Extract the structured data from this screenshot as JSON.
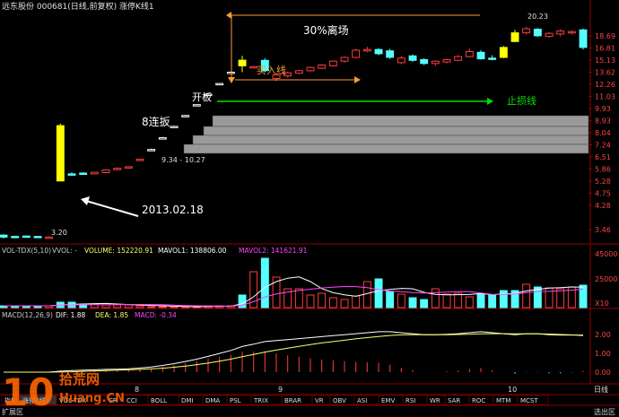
{
  "header": {
    "title": "远东股份 000681(日线,前复权) 涨停K线1"
  },
  "colors": {
    "up": "#ff3c3c",
    "down": "#54ffff",
    "limit_up": "#ffff00",
    "white": "#ffffff",
    "grid": "#8b0000",
    "orange": "#ff9a2e",
    "green": "#00e000",
    "magenta": "#ff44ff",
    "yellow_line": "#ffff66"
  },
  "annotations": {
    "date_label": "2013.02.18",
    "board_label": "8连扳",
    "gap_label": "9.34 - 10.27",
    "open_label": "开板",
    "buy_label": "买入线",
    "stop_label": "止损线",
    "leave_label": "30%离场",
    "low_label": "3.20",
    "high_label": "20.23"
  },
  "price_axis": [
    "18.69",
    "16.81",
    "15.13",
    "13.62",
    "12.26",
    "11.03",
    "9.93",
    "8.93",
    "8.04",
    "7.24",
    "6.51",
    "5.86",
    "5.28",
    "4.75",
    "4.28",
    "3.46"
  ],
  "vol_panel": {
    "title": "VOL-TDX(5,10)",
    "vvol": "VVOL: -",
    "volume": "VOLUME: 152220.91",
    "mavol1": "MAVOL1: 138806.00",
    "mavol2": "MAVOL2: 141621.91",
    "axis": [
      "45000",
      "25000",
      "X10"
    ]
  },
  "macd_panel": {
    "title": "MACD(12,26,9)",
    "dif": "DIF: 1.88",
    "dea": "DEA: 1.85",
    "macd": "MACD: -0.34",
    "axis": [
      "2.00",
      "1.00",
      "0.00"
    ]
  },
  "time_axis": {
    "labels": [
      "8",
      "9",
      "10"
    ],
    "period": "日线"
  },
  "tabs": [
    "指标",
    "涨停K线1",
    "VOL-TDX",
    "CR",
    "CCI",
    "BOLL",
    "DMI",
    "DMA",
    "PSL",
    "TRIX",
    "BRAR",
    "VR",
    "OBV",
    "ASI",
    "EMV",
    "RSI",
    "WR",
    "SAR",
    "ROC",
    "MTM",
    "MCST"
  ],
  "bottom_left": "扩展区",
  "bottom_right": "选出区",
  "watermark": {
    "digits": "10",
    "brand": "拾荒网",
    "url": "Huang.CN"
  },
  "chart_data": {
    "type": "candlestick",
    "title": "远东股份 000681(日线,前复权) 涨停K线1",
    "ylim": [
      3.0,
      21.0
    ],
    "y_scale": "log",
    "candles": [
      {
        "o": 3.3,
        "h": 3.32,
        "l": 3.2,
        "c": 3.24,
        "k": "down"
      },
      {
        "o": 3.25,
        "h": 3.28,
        "l": 3.22,
        "c": 3.26,
        "k": "down"
      },
      {
        "o": 3.27,
        "h": 3.28,
        "l": 3.24,
        "c": 3.25,
        "k": "down"
      },
      {
        "o": 3.26,
        "h": 3.27,
        "l": 3.22,
        "c": 3.24,
        "k": "down"
      },
      {
        "o": 3.24,
        "h": 3.26,
        "l": 3.2,
        "c": 3.22,
        "k": "up"
      },
      {
        "o": 5.28,
        "h": 8.7,
        "l": 5.28,
        "c": 8.55,
        "k": "limit"
      },
      {
        "o": 5.6,
        "h": 5.7,
        "l": 5.55,
        "c": 5.62,
        "k": "down"
      },
      {
        "o": 5.63,
        "h": 5.7,
        "l": 5.58,
        "c": 5.66,
        "k": "down"
      },
      {
        "o": 5.62,
        "h": 5.72,
        "l": 5.6,
        "c": 5.7,
        "k": "up"
      },
      {
        "o": 5.68,
        "h": 5.85,
        "l": 5.66,
        "c": 5.82,
        "k": "up"
      },
      {
        "o": 5.84,
        "h": 5.95,
        "l": 5.8,
        "c": 5.9,
        "k": "up"
      },
      {
        "o": 5.95,
        "h": 6.0,
        "l": 5.9,
        "c": 5.98,
        "k": "up"
      },
      {
        "o": 6.35,
        "h": 6.4,
        "l": 6.3,
        "c": 6.38,
        "k": "up"
      },
      {
        "o": 6.95,
        "h": 7.0,
        "l": 6.9,
        "c": 6.95,
        "k": "up"
      },
      {
        "o": 7.7,
        "h": 7.75,
        "l": 7.65,
        "c": 7.7,
        "k": "up"
      },
      {
        "o": 8.5,
        "h": 8.55,
        "l": 8.45,
        "c": 8.5,
        "k": "up"
      },
      {
        "o": 9.34,
        "h": 9.4,
        "l": 9.3,
        "c": 9.34,
        "k": "up"
      },
      {
        "o": 10.27,
        "h": 10.3,
        "l": 10.25,
        "c": 10.27,
        "k": "up"
      },
      {
        "o": 11.25,
        "h": 11.3,
        "l": 11.2,
        "c": 11.25,
        "k": "up"
      },
      {
        "o": 12.35,
        "h": 12.4,
        "l": 12.3,
        "c": 12.35,
        "k": "up"
      },
      {
        "o": 13.62,
        "h": 13.7,
        "l": 13.55,
        "c": 13.62,
        "k": "up"
      },
      {
        "o": 14.4,
        "h": 15.7,
        "l": 13.62,
        "c": 15.13,
        "k": "limit"
      },
      {
        "o": 14.2,
        "h": 14.4,
        "l": 14.1,
        "c": 14.3,
        "k": "up"
      },
      {
        "o": 15.1,
        "h": 15.4,
        "l": 13.6,
        "c": 13.8,
        "k": "down"
      },
      {
        "o": 12.9,
        "h": 13.5,
        "l": 12.6,
        "c": 13.3,
        "k": "up"
      },
      {
        "o": 13.2,
        "h": 13.7,
        "l": 13.0,
        "c": 13.55,
        "k": "up"
      },
      {
        "o": 13.5,
        "h": 13.9,
        "l": 13.4,
        "c": 13.8,
        "k": "up"
      },
      {
        "o": 13.8,
        "h": 14.3,
        "l": 13.7,
        "c": 14.2,
        "k": "up"
      },
      {
        "o": 14.1,
        "h": 14.6,
        "l": 14.0,
        "c": 14.5,
        "k": "up"
      },
      {
        "o": 14.4,
        "h": 15.1,
        "l": 14.3,
        "c": 15.0,
        "k": "up"
      },
      {
        "o": 15.0,
        "h": 15.6,
        "l": 14.8,
        "c": 15.5,
        "k": "up"
      },
      {
        "o": 15.5,
        "h": 16.7,
        "l": 15.4,
        "c": 16.5,
        "k": "up"
      },
      {
        "o": 16.4,
        "h": 17.0,
        "l": 16.2,
        "c": 16.6,
        "k": "up"
      },
      {
        "o": 16.6,
        "h": 16.8,
        "l": 15.8,
        "c": 16.0,
        "k": "down"
      },
      {
        "o": 16.4,
        "h": 16.7,
        "l": 15.3,
        "c": 15.5,
        "k": "down"
      },
      {
        "o": 15.4,
        "h": 15.7,
        "l": 14.6,
        "c": 14.8,
        "k": "up"
      },
      {
        "o": 15.7,
        "h": 15.9,
        "l": 14.9,
        "c": 15.1,
        "k": "down"
      },
      {
        "o": 15.2,
        "h": 15.4,
        "l": 14.5,
        "c": 14.7,
        "k": "down"
      },
      {
        "o": 14.7,
        "h": 15.1,
        "l": 14.4,
        "c": 15.0,
        "k": "up"
      },
      {
        "o": 14.9,
        "h": 15.3,
        "l": 14.7,
        "c": 15.2,
        "k": "up"
      },
      {
        "o": 15.1,
        "h": 15.8,
        "l": 15.0,
        "c": 15.6,
        "k": "up"
      },
      {
        "o": 15.6,
        "h": 16.7,
        "l": 15.5,
        "c": 16.3,
        "k": "up"
      },
      {
        "o": 16.2,
        "h": 16.5,
        "l": 15.2,
        "c": 15.3,
        "k": "down"
      },
      {
        "o": 15.3,
        "h": 15.8,
        "l": 15.1,
        "c": 15.4,
        "k": "down"
      },
      {
        "o": 15.5,
        "h": 17.1,
        "l": 15.4,
        "c": 16.9,
        "k": "limit"
      },
      {
        "o": 17.8,
        "h": 19.7,
        "l": 17.8,
        "c": 19.2,
        "k": "limit"
      },
      {
        "o": 19.2,
        "h": 20.23,
        "l": 18.9,
        "c": 19.9,
        "k": "up"
      },
      {
        "o": 19.8,
        "h": 20.0,
        "l": 18.5,
        "c": 18.7,
        "k": "down"
      },
      {
        "o": 18.6,
        "h": 19.3,
        "l": 18.4,
        "c": 19.1,
        "k": "up"
      },
      {
        "o": 19.0,
        "h": 19.8,
        "l": 18.6,
        "c": 19.5,
        "k": "up"
      },
      {
        "o": 19.4,
        "h": 19.6,
        "l": 18.9,
        "c": 19.2,
        "k": "up"
      },
      {
        "o": 19.7,
        "h": 19.9,
        "l": 16.6,
        "c": 16.9,
        "k": "down"
      }
    ],
    "volume": [
      2,
      2,
      2,
      2,
      2,
      6,
      6,
      4,
      4,
      3,
      3,
      3,
      2,
      1,
      1,
      1,
      1,
      1,
      2,
      2,
      2,
      14,
      40,
      55,
      34,
      21,
      21,
      14,
      16,
      11,
      9,
      13,
      29,
      32,
      18,
      15,
      11,
      9,
      21,
      15,
      16,
      12,
      15,
      14,
      19,
      19,
      26,
      23,
      22,
      21,
      23,
      25
    ],
    "macd_dif": [
      0,
      0,
      0,
      0,
      0,
      0.05,
      0.08,
      0.1,
      0.12,
      0.14,
      0.15,
      0.17,
      0.21,
      0.26,
      0.34,
      0.43,
      0.54,
      0.66,
      0.8,
      0.95,
      1.1,
      1.3,
      1.42,
      1.55,
      1.6,
      1.65,
      1.7,
      1.75,
      1.8,
      1.85,
      1.9,
      1.95,
      2.0,
      2.05,
      2.05,
      2.0,
      1.95,
      1.9,
      1.9,
      1.92,
      1.95,
      2.0,
      2.05,
      2.0,
      1.95,
      1.9,
      1.95,
      1.95,
      1.9,
      1.88,
      1.88,
      1.88
    ],
    "macd_dea": [
      0,
      0,
      0,
      0,
      0,
      0.01,
      0.02,
      0.04,
      0.06,
      0.08,
      0.1,
      0.12,
      0.14,
      0.17,
      0.2,
      0.25,
      0.31,
      0.38,
      0.46,
      0.56,
      0.66,
      0.78,
      0.9,
      1.02,
      1.12,
      1.22,
      1.31,
      1.4,
      1.48,
      1.55,
      1.62,
      1.69,
      1.75,
      1.81,
      1.86,
      1.89,
      1.9,
      1.9,
      1.9,
      1.9,
      1.91,
      1.92,
      1.94,
      1.95,
      1.95,
      1.94,
      1.94,
      1.94,
      1.93,
      1.91,
      1.89,
      1.85
    ]
  }
}
